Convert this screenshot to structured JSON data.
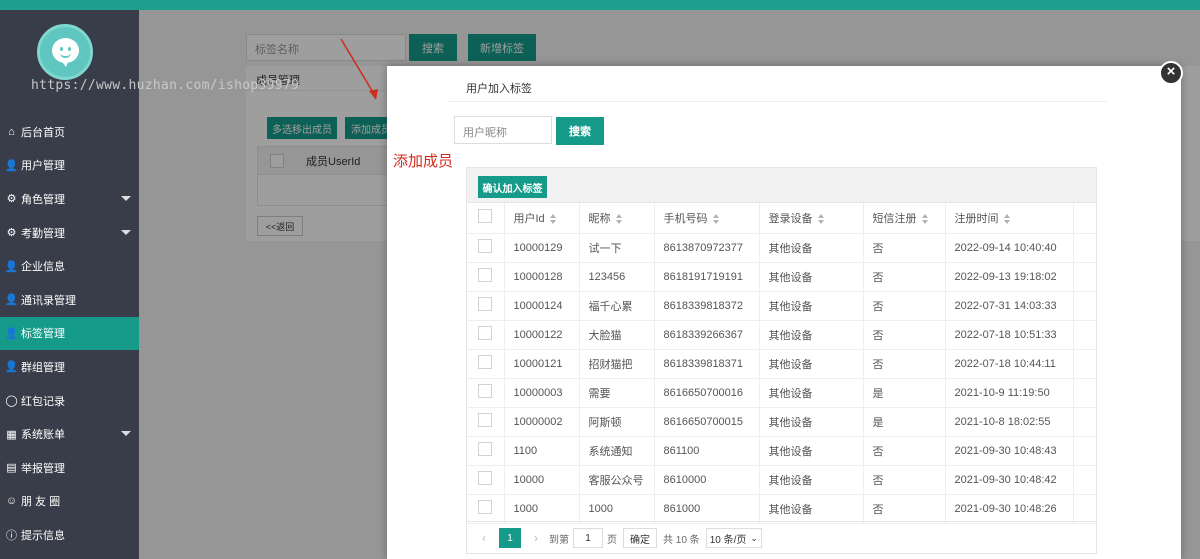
{
  "watermark": "https://www.huzhan.com/ishop39979",
  "sidebar": {
    "items": [
      {
        "icon": "home-icon",
        "glyph": "⌂",
        "label": "后台首页",
        "caret": false,
        "active": false
      },
      {
        "icon": "user-icon",
        "glyph": "👤",
        "label": "用户管理",
        "caret": false,
        "active": false
      },
      {
        "icon": "gear-icon",
        "glyph": "⚙",
        "label": "角色管理",
        "caret": true,
        "active": false
      },
      {
        "icon": "gear-icon",
        "glyph": "⚙",
        "label": "考勤管理",
        "caret": true,
        "active": false
      },
      {
        "icon": "user-icon",
        "glyph": "👤",
        "label": "企业信息",
        "caret": false,
        "active": false
      },
      {
        "icon": "user-icon",
        "glyph": "👤",
        "label": "通讯录管理",
        "caret": false,
        "active": false
      },
      {
        "icon": "user-icon",
        "glyph": "👤",
        "label": "标签管理",
        "caret": false,
        "active": true
      },
      {
        "icon": "user-icon",
        "glyph": "👤",
        "label": "群组管理",
        "caret": false,
        "active": false
      },
      {
        "icon": "circle-icon",
        "glyph": "◯",
        "label": "红包记录",
        "caret": false,
        "active": false
      },
      {
        "icon": "table-icon",
        "glyph": "▦",
        "label": "系统账单",
        "caret": true,
        "active": false
      },
      {
        "icon": "report-icon",
        "glyph": "▤",
        "label": "举报管理",
        "caret": false,
        "active": false
      },
      {
        "icon": "smile-icon",
        "glyph": "☺",
        "label": "朋 友 圈",
        "caret": false,
        "active": false
      },
      {
        "icon": "info-icon",
        "glyph": "ⓘ",
        "label": "提示信息",
        "caret": false,
        "active": false
      }
    ]
  },
  "background": {
    "search_placeholder": "标签名称",
    "search_button": "搜索",
    "add_tag_button": "新增标签",
    "panel_title": "成员管理",
    "remove_members_button": "多选移出成员",
    "add_member_button": "添加成员",
    "column_userid": "成员UserId",
    "back_button": "<<返回"
  },
  "annotation": "添加成员",
  "modal": {
    "title": "用户加入标签",
    "nickname_placeholder": "用户昵称",
    "search_button": "搜索",
    "confirm_button": "确认加入标签",
    "columns": [
      "用户Id",
      "昵称",
      "手机号码",
      "登录设备",
      "短信注册",
      "注册时间"
    ],
    "rows": [
      [
        "10000129",
        "试一下",
        "8613870972377",
        "其他设备",
        "否",
        "2022-09-14 10:40:40"
      ],
      [
        "10000128",
        "123456",
        "8618191719191",
        "其他设备",
        "否",
        "2022-09-13 19:18:02"
      ],
      [
        "10000124",
        "福千心累",
        "8618339818372",
        "其他设备",
        "否",
        "2022-07-31 14:03:33"
      ],
      [
        "10000122",
        "大脸猫",
        "8618339266367",
        "其他设备",
        "否",
        "2022-07-18 10:51:33"
      ],
      [
        "10000121",
        "招财猫把",
        "8618339818371",
        "其他设备",
        "否",
        "2022-07-18 10:44:11"
      ],
      [
        "10000003",
        "需要",
        "8616650700016",
        "其他设备",
        "是",
        "2021-10-9 11:19:50"
      ],
      [
        "10000002",
        "阿斯顿",
        "8616650700015",
        "其他设备",
        "是",
        "2021-10-8 18:02:55"
      ],
      [
        "1100",
        "系统通知",
        "861100",
        "其他设备",
        "否",
        "2021-09-30 10:48:43"
      ],
      [
        "10000",
        "客服公众号",
        "8610000",
        "其他设备",
        "否",
        "2021-09-30 10:48:42"
      ],
      [
        "1000",
        "1000",
        "861000",
        "其他设备",
        "否",
        "2021-09-30 10:48:26"
      ]
    ],
    "pager": {
      "prev": "‹",
      "current": "1",
      "next": "›",
      "goto_label": "到第",
      "goto_value": "1",
      "page_label": "页",
      "confirm": "确定",
      "total": "共 10 条",
      "page_size": "10 条/页"
    }
  }
}
